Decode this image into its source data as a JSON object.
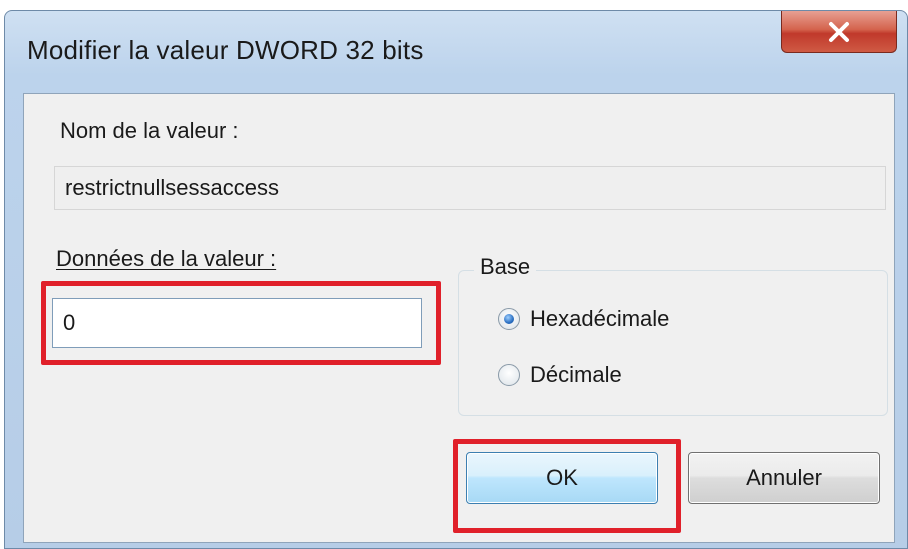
{
  "dialog": {
    "title": "Modifier la valeur DWORD 32 bits",
    "close_icon": "close-icon"
  },
  "value_name": {
    "label": "Nom de la valeur :",
    "value": "restrictnullsessaccess"
  },
  "value_data": {
    "label": "Données de la valeur :",
    "value": "0"
  },
  "base": {
    "label": "Base",
    "options": [
      {
        "label": "Hexadécimale",
        "selected": true
      },
      {
        "label": "Décimale",
        "selected": false
      }
    ]
  },
  "buttons": {
    "ok": "OK",
    "cancel": "Annuler"
  },
  "colors": {
    "highlight": "#e0202a",
    "close_button": "#c0392b",
    "ok_button_border": "#3c7fb1"
  }
}
